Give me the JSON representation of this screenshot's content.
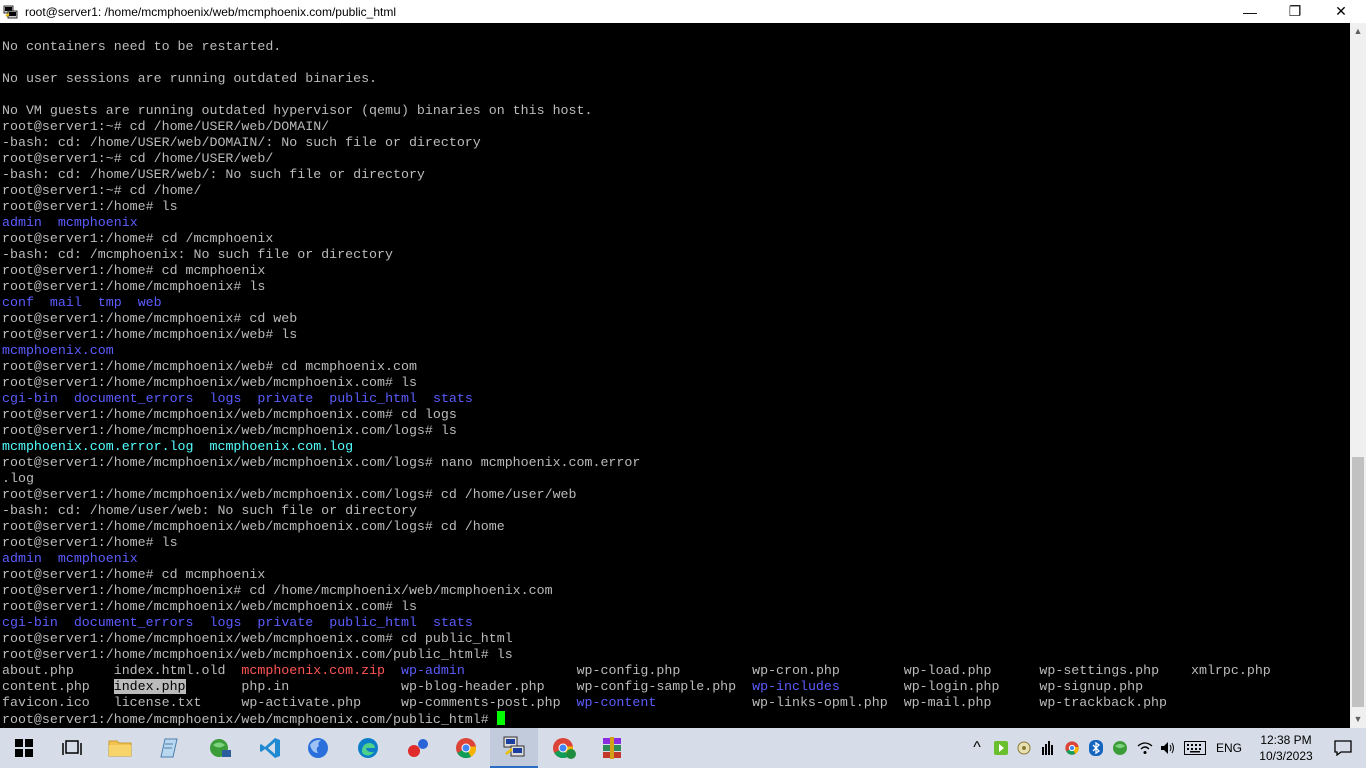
{
  "window": {
    "title": "root@server1: /home/mcmphoenix/web/mcmphoenix.com/public_html",
    "minimize_glyph": "—",
    "maximize_glyph": "❐",
    "close_glyph": "✕"
  },
  "terminal": {
    "lines": [
      [
        {
          "t": "No containers need to be restarted."
        }
      ],
      [
        {
          "t": ""
        }
      ],
      [
        {
          "t": "No user sessions are running outdated binaries."
        }
      ],
      [
        {
          "t": ""
        }
      ],
      [
        {
          "t": "No VM guests are running outdated hypervisor (qemu) binaries on this host."
        }
      ],
      [
        {
          "t": "root@server1:~# cd /home/USER/web/DOMAIN/"
        }
      ],
      [
        {
          "t": "-bash: cd: /home/USER/web/DOMAIN/: No such file or directory"
        }
      ],
      [
        {
          "t": "root@server1:~# cd /home/USER/web/"
        }
      ],
      [
        {
          "t": "-bash: cd: /home/USER/web/: No such file or directory"
        }
      ],
      [
        {
          "t": "root@server1:~# cd /home/"
        }
      ],
      [
        {
          "t": "root@server1:/home# ls"
        }
      ],
      [
        {
          "t": "admin",
          "c": "blue"
        },
        {
          "t": "  "
        },
        {
          "t": "mcmphoenix",
          "c": "blue"
        }
      ],
      [
        {
          "t": "root@server1:/home# cd /mcmphoenix"
        }
      ],
      [
        {
          "t": "-bash: cd: /mcmphoenix: No such file or directory"
        }
      ],
      [
        {
          "t": "root@server1:/home# cd mcmphoenix"
        }
      ],
      [
        {
          "t": "root@server1:/home/mcmphoenix# ls"
        }
      ],
      [
        {
          "t": "conf",
          "c": "blue"
        },
        {
          "t": "  "
        },
        {
          "t": "mail",
          "c": "blue"
        },
        {
          "t": "  "
        },
        {
          "t": "tmp",
          "c": "blue"
        },
        {
          "t": "  "
        },
        {
          "t": "web",
          "c": "blue"
        }
      ],
      [
        {
          "t": "root@server1:/home/mcmphoenix# cd web"
        }
      ],
      [
        {
          "t": "root@server1:/home/mcmphoenix/web# ls"
        }
      ],
      [
        {
          "t": "mcmphoenix.com",
          "c": "blue"
        }
      ],
      [
        {
          "t": "root@server1:/home/mcmphoenix/web# cd mcmphoenix.com"
        }
      ],
      [
        {
          "t": "root@server1:/home/mcmphoenix/web/mcmphoenix.com# ls"
        }
      ],
      [
        {
          "t": "cgi-bin",
          "c": "blue"
        },
        {
          "t": "  "
        },
        {
          "t": "document_errors",
          "c": "blue"
        },
        {
          "t": "  "
        },
        {
          "t": "logs",
          "c": "blue"
        },
        {
          "t": "  "
        },
        {
          "t": "private",
          "c": "blue"
        },
        {
          "t": "  "
        },
        {
          "t": "public_html",
          "c": "blue"
        },
        {
          "t": "  "
        },
        {
          "t": "stats",
          "c": "blue"
        }
      ],
      [
        {
          "t": "root@server1:/home/mcmphoenix/web/mcmphoenix.com# cd logs"
        }
      ],
      [
        {
          "t": "root@server1:/home/mcmphoenix/web/mcmphoenix.com/logs# ls"
        }
      ],
      [
        {
          "t": "mcmphoenix.com.error.log",
          "c": "cyan"
        },
        {
          "t": "  "
        },
        {
          "t": "mcmphoenix.com.log",
          "c": "cyan"
        }
      ],
      [
        {
          "t": "root@server1:/home/mcmphoenix/web/mcmphoenix.com/logs# nano mcmphoenix.com.error"
        }
      ],
      [
        {
          "t": ".log"
        }
      ],
      [
        {
          "t": "root@server1:/home/mcmphoenix/web/mcmphoenix.com/logs# cd /home/user/web"
        }
      ],
      [
        {
          "t": "-bash: cd: /home/user/web: No such file or directory"
        }
      ],
      [
        {
          "t": "root@server1:/home/mcmphoenix/web/mcmphoenix.com/logs# cd /home"
        }
      ],
      [
        {
          "t": "root@server1:/home# ls"
        }
      ],
      [
        {
          "t": "admin",
          "c": "blue"
        },
        {
          "t": "  "
        },
        {
          "t": "mcmphoenix",
          "c": "blue"
        }
      ],
      [
        {
          "t": "root@server1:/home# cd mcmphoenix"
        }
      ],
      [
        {
          "t": "root@server1:/home/mcmphoenix# cd /home/mcmphoenix/web/mcmphoenix.com"
        }
      ],
      [
        {
          "t": "root@server1:/home/mcmphoenix/web/mcmphoenix.com# ls"
        }
      ],
      [
        {
          "t": "cgi-bin",
          "c": "blue"
        },
        {
          "t": "  "
        },
        {
          "t": "document_errors",
          "c": "blue"
        },
        {
          "t": "  "
        },
        {
          "t": "logs",
          "c": "blue"
        },
        {
          "t": "  "
        },
        {
          "t": "private",
          "c": "blue"
        },
        {
          "t": "  "
        },
        {
          "t": "public_html",
          "c": "blue"
        },
        {
          "t": "  "
        },
        {
          "t": "stats",
          "c": "blue"
        }
      ],
      [
        {
          "t": "root@server1:/home/mcmphoenix/web/mcmphoenix.com# cd public_html"
        }
      ],
      [
        {
          "t": "root@server1:/home/mcmphoenix/web/mcmphoenix.com/public_html# ls"
        }
      ],
      [
        {
          "t": "about.php     "
        },
        {
          "t": "index.html.old"
        },
        {
          "t": "  "
        },
        {
          "t": "mcmphoenix.com.zip",
          "c": "red"
        },
        {
          "t": "  "
        },
        {
          "t": "wp-admin",
          "c": "blue"
        },
        {
          "t": "              wp-config.php         wp-cron.php        wp-load.php      wp-settings.php    xmlrpc.php"
        }
      ],
      [
        {
          "t": "content.php   "
        },
        {
          "t": "index.php",
          "c": "hl"
        },
        {
          "t": "       php.in              wp-blog-header.php    wp-config-sample.php  "
        },
        {
          "t": "wp-includes",
          "c": "blue"
        },
        {
          "t": "        wp-login.php     wp-signup.php"
        }
      ],
      [
        {
          "t": "favicon.ico   license.txt     wp-activate.php     wp-comments-post.php  "
        },
        {
          "t": "wp-content",
          "c": "blue"
        },
        {
          "t": "            wp-links-opml.php  wp-mail.php      wp-trackback.php"
        }
      ],
      [
        {
          "t": "root@server1:/home/mcmphoenix/web/mcmphoenix.com/public_html# "
        },
        {
          "t": "",
          "c": "cursor"
        }
      ]
    ]
  },
  "taskbar": {
    "apps": [
      {
        "name": "start-button",
        "icon": "windows-logo-icon"
      },
      {
        "name": "task-view-button",
        "icon": "task-view-icon"
      },
      {
        "name": "file-explorer-button",
        "icon": "folder-icon"
      },
      {
        "name": "notepad-button",
        "icon": "notepad-icon"
      },
      {
        "name": "network-app-button",
        "icon": "globe-network-icon"
      },
      {
        "name": "vscode-button",
        "icon": "vscode-icon"
      },
      {
        "name": "firefox-button",
        "icon": "firefox-icon"
      },
      {
        "name": "edge-button",
        "icon": "edge-icon"
      },
      {
        "name": "app-dots-button",
        "icon": "dots-icon"
      },
      {
        "name": "chrome-button",
        "icon": "chrome-icon"
      },
      {
        "name": "putty-button",
        "icon": "putty-icon"
      },
      {
        "name": "chrome-profile-button",
        "icon": "chrome-profile-icon"
      },
      {
        "name": "winrar-button",
        "icon": "winrar-icon"
      }
    ],
    "language": "ENG",
    "time": "12:38 PM",
    "date": "10/3/2023",
    "tray_overflow_glyph": "^"
  }
}
